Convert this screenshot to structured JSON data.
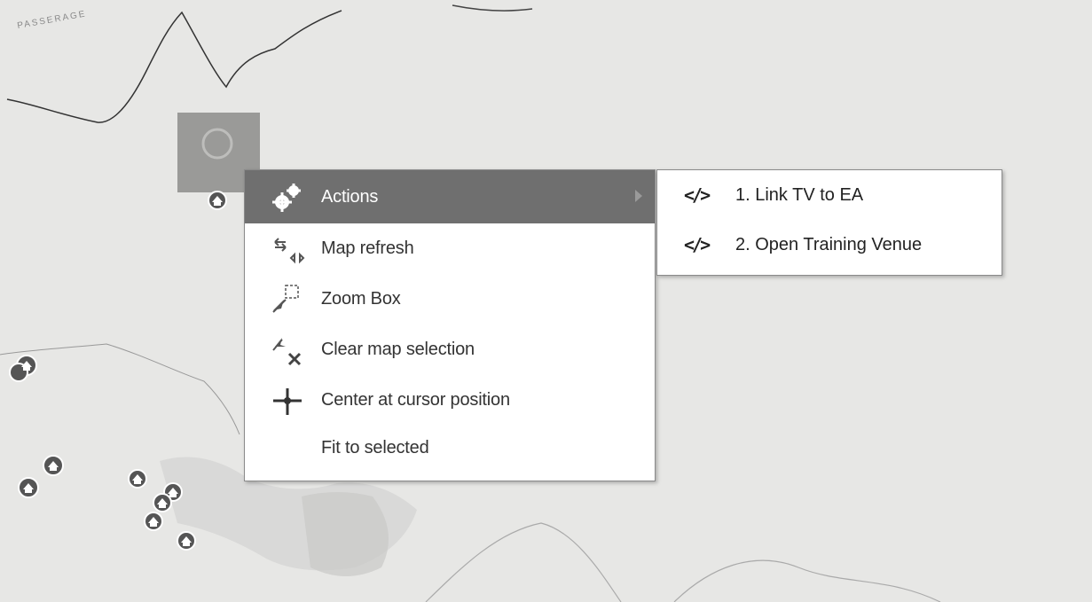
{
  "context_menu": {
    "items": [
      {
        "label": "Actions",
        "icon": "gears-icon",
        "has_submenu": true
      },
      {
        "label": "Map refresh",
        "icon": "refresh-arrows-icon"
      },
      {
        "label": "Zoom Box",
        "icon": "zoom-box-icon"
      },
      {
        "label": "Clear map selection",
        "icon": "clear-selection-icon"
      },
      {
        "label": "Center at cursor position",
        "icon": "crosshair-icon"
      },
      {
        "label": "Fit to selected",
        "icon": ""
      }
    ]
  },
  "submenu": {
    "items": [
      {
        "label": "1. Link TV to EA",
        "icon": "code-tag-icon",
        "glyph": "</>"
      },
      {
        "label": "2. Open Training Venue",
        "icon": "code-tag-icon",
        "glyph": "</>"
      }
    ]
  },
  "map": {
    "coastline_text": "PASSERAGE"
  },
  "colors": {
    "menu_highlight": "#6f6f6f",
    "marker": "#555555",
    "map_background": "#e9e9e7"
  }
}
